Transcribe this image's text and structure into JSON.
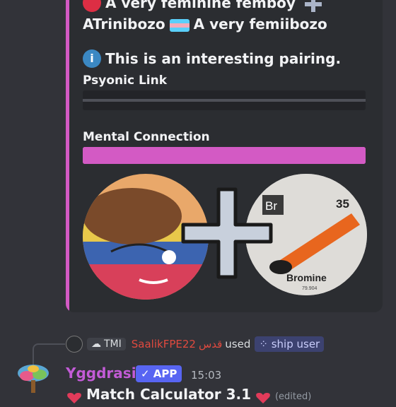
{
  "embed": {
    "line1_text": "A very feminine femboy",
    "line2_name": "ATrinibozo",
    "line2_text": "A very femiibozo",
    "pairing_text": "This is an interesting pairing.",
    "psyonic_label": "Psyonic Link",
    "psyonic_value": 0,
    "mental_label": "Mental Connection",
    "mental_value": 100,
    "bromine_number": "35",
    "bromine_symbol": "Br",
    "bromine_name": "Bromine",
    "bromine_mass": "79.904"
  },
  "reply": {
    "tag_label": "TMI",
    "name": "SaalikFPE22",
    "name_suffix": "قدس",
    "used_text": "used",
    "command": "ship user"
  },
  "message": {
    "username": "Yggdrasil",
    "badge": "APP",
    "time": "15:03",
    "title": "Match Calculator 3.1",
    "edited": "(edited)"
  },
  "colors": {
    "accent": "#d35ac4",
    "username": "#c25bd6",
    "app_badge": "#5865f2"
  }
}
